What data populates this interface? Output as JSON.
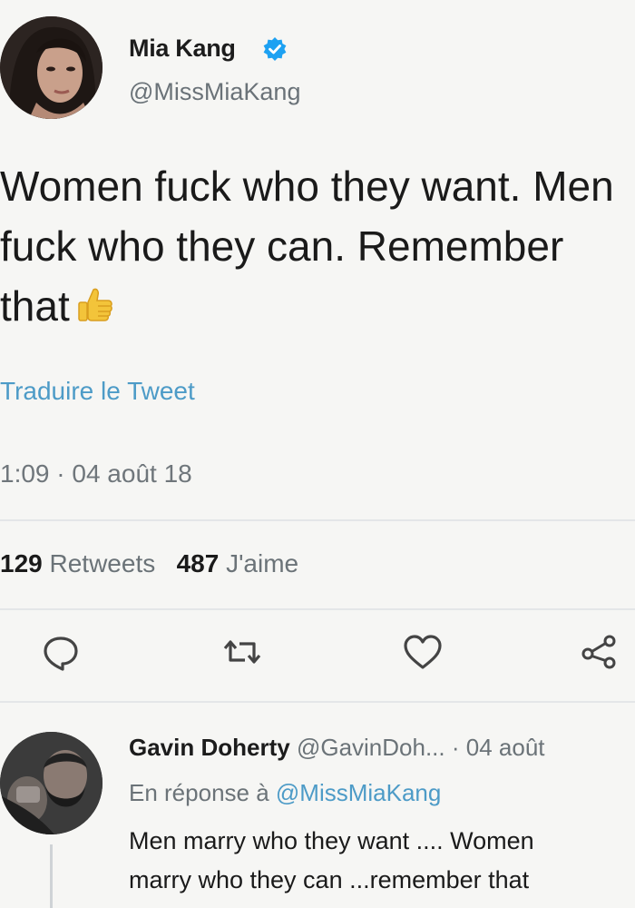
{
  "tweet": {
    "author_name": "Mia Kang",
    "author_handle": "@MissMiaKang",
    "verified_icon": "verified-badge-icon",
    "text_line1": "Women fuck who they want. Men",
    "text_line2": "fuck who they can. Remember",
    "text_line3": "that",
    "emoji": "thumbs-up-icon",
    "translate_label": "Traduire le Tweet",
    "timestamp": "1:09 · 04 août 18",
    "retweets_count": "129",
    "retweets_label": "Retweets",
    "likes_count": "487",
    "likes_label": "J'aime"
  },
  "actions": [
    "reply-icon",
    "retweet-icon",
    "like-icon",
    "share-icon"
  ],
  "reply": {
    "author_name": "Gavin Doherty",
    "author_handle": "@GavinDoh...",
    "time": "· 04 août",
    "in_reply_prefix": "En réponse à",
    "in_reply_handle": "@MissMiaKang",
    "text_line1": "Men marry who they want .... Women",
    "text_line2": "marry who they can ...remember that"
  },
  "colors": {
    "link": "#4d9bc7",
    "muted": "#6b7378",
    "verified": "#1da1f2"
  }
}
